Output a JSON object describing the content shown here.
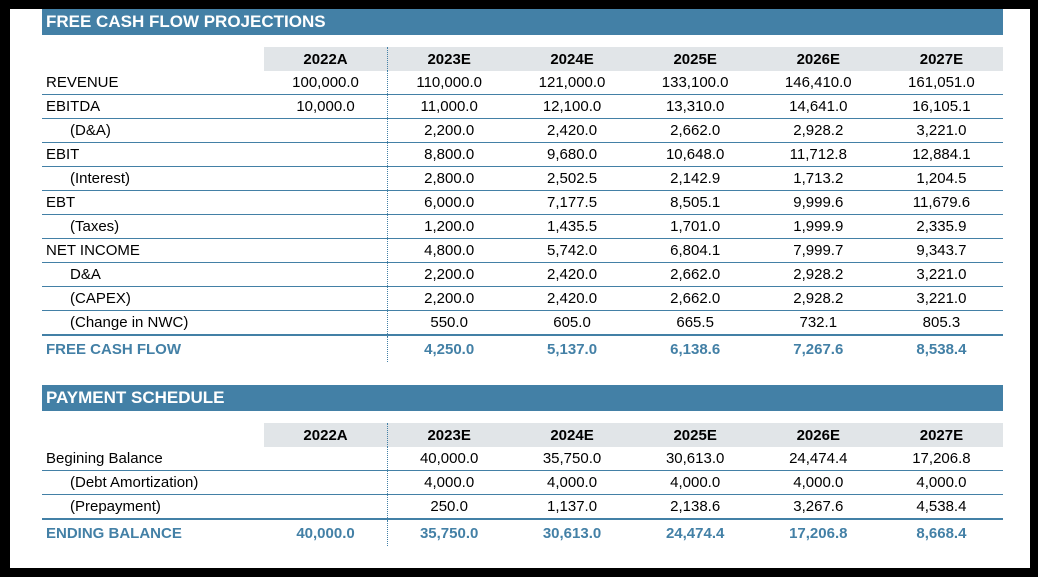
{
  "fcf": {
    "title": "FREE CASH FLOW PROJECTIONS",
    "columns": [
      "2022A",
      "2023E",
      "2024E",
      "2025E",
      "2026E",
      "2027E"
    ],
    "rows": [
      {
        "label": "REVENUE",
        "indent": false,
        "values": [
          "100,000.0",
          "110,000.0",
          "121,000.0",
          "133,100.0",
          "146,410.0",
          "161,051.0"
        ]
      },
      {
        "label": "EBITDA",
        "indent": false,
        "values": [
          "10,000.0",
          "11,000.0",
          "12,100.0",
          "13,310.0",
          "14,641.0",
          "16,105.1"
        ]
      },
      {
        "label": "(D&A)",
        "indent": true,
        "values": [
          "",
          "2,200.0",
          "2,420.0",
          "2,662.0",
          "2,928.2",
          "3,221.0"
        ]
      },
      {
        "label": "EBIT",
        "indent": false,
        "values": [
          "",
          "8,800.0",
          "9,680.0",
          "10,648.0",
          "11,712.8",
          "12,884.1"
        ]
      },
      {
        "label": "(Interest)",
        "indent": true,
        "values": [
          "",
          "2,800.0",
          "2,502.5",
          "2,142.9",
          "1,713.2",
          "1,204.5"
        ]
      },
      {
        "label": "EBT",
        "indent": false,
        "values": [
          "",
          "6,000.0",
          "7,177.5",
          "8,505.1",
          "9,999.6",
          "11,679.6"
        ]
      },
      {
        "label": "(Taxes)",
        "indent": true,
        "values": [
          "",
          "1,200.0",
          "1,435.5",
          "1,701.0",
          "1,999.9",
          "2,335.9"
        ]
      },
      {
        "label": "NET INCOME",
        "indent": false,
        "values": [
          "",
          "4,800.0",
          "5,742.0",
          "6,804.1",
          "7,999.7",
          "9,343.7"
        ]
      },
      {
        "label": "D&A",
        "indent": true,
        "values": [
          "",
          "2,200.0",
          "2,420.0",
          "2,662.0",
          "2,928.2",
          "3,221.0"
        ]
      },
      {
        "label": "(CAPEX)",
        "indent": true,
        "values": [
          "",
          "2,200.0",
          "2,420.0",
          "2,662.0",
          "2,928.2",
          "3,221.0"
        ]
      },
      {
        "label": "(Change in NWC)",
        "indent": true,
        "values": [
          "",
          "550.0",
          "605.0",
          "665.5",
          "732.1",
          "805.3"
        ]
      }
    ],
    "total": {
      "label": "FREE CASH FLOW",
      "values": [
        "",
        "4,250.0",
        "5,137.0",
        "6,138.6",
        "7,267.6",
        "8,538.4"
      ]
    }
  },
  "payment": {
    "title": "PAYMENT SCHEDULE",
    "columns": [
      "2022A",
      "2023E",
      "2024E",
      "2025E",
      "2026E",
      "2027E"
    ],
    "rows": [
      {
        "label": "Begining Balance",
        "indent": false,
        "values": [
          "",
          "40,000.0",
          "35,750.0",
          "30,613.0",
          "24,474.4",
          "17,206.8"
        ]
      },
      {
        "label": "(Debt Amortization)",
        "indent": true,
        "values": [
          "",
          "4,000.0",
          "4,000.0",
          "4,000.0",
          "4,000.0",
          "4,000.0"
        ]
      },
      {
        "label": "(Prepayment)",
        "indent": true,
        "values": [
          "",
          "250.0",
          "1,137.0",
          "2,138.6",
          "3,267.6",
          "4,538.4"
        ]
      }
    ],
    "total": {
      "label": "ENDING BALANCE",
      "values": [
        "40,000.0",
        "35,750.0",
        "30,613.0",
        "24,474.4",
        "17,206.8",
        "8,668.4"
      ]
    }
  },
  "colors": {
    "accent": "#4380a6",
    "header_fill": "#e1e5e8"
  }
}
